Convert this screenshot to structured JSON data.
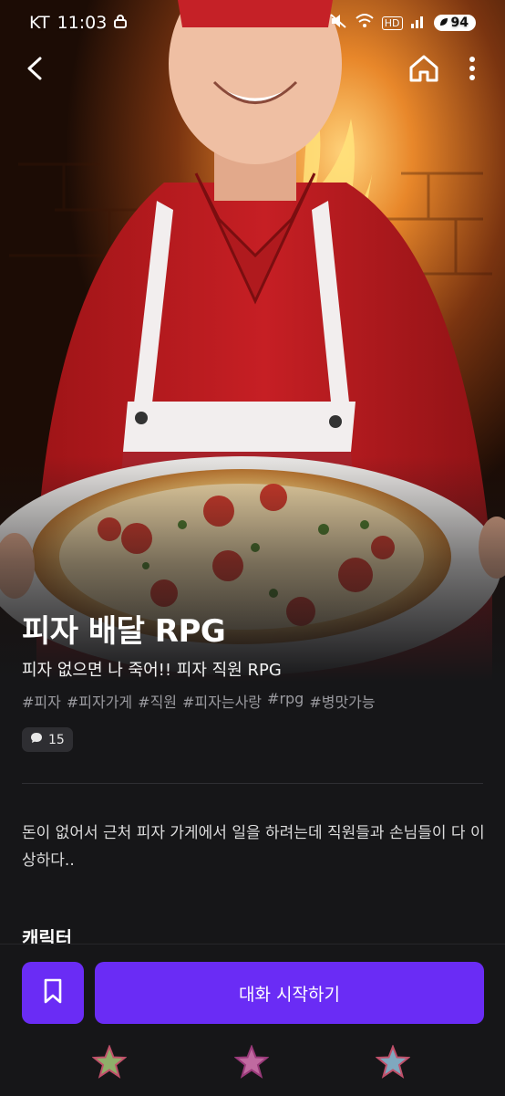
{
  "status_bar": {
    "carrier": "KT",
    "time": "11:03",
    "battery": "94",
    "network_badge": "HD"
  },
  "icons": {
    "back": "chevron-left-icon",
    "home": "home-icon",
    "more": "more-vertical-icon",
    "comment": "speech-bubble-icon",
    "bookmark": "bookmark-icon"
  },
  "story": {
    "title": "피자 배달 RPG",
    "subtitle": "피자 없으면 나 죽어!! 피자 직원 RPG",
    "tags": [
      "#피자",
      "#피자가게",
      "#직원",
      "#피자는사랑",
      "#rpg",
      "#병맛가능"
    ],
    "comment_count": "15",
    "description": "돈이 없어서 근처 피자 가게에서 일을 하려는데 직원들과 손님들이 다 이상하다..",
    "section_heading": "캐릭터"
  },
  "actions": {
    "start_chat_label": "대화 시작하기"
  },
  "bottom_nav": {
    "star_colors": [
      "#8fae6a",
      "#c06aa0",
      "#7fa8bf"
    ]
  },
  "colors": {
    "accent": "#6a2cf5",
    "background": "#161618"
  }
}
